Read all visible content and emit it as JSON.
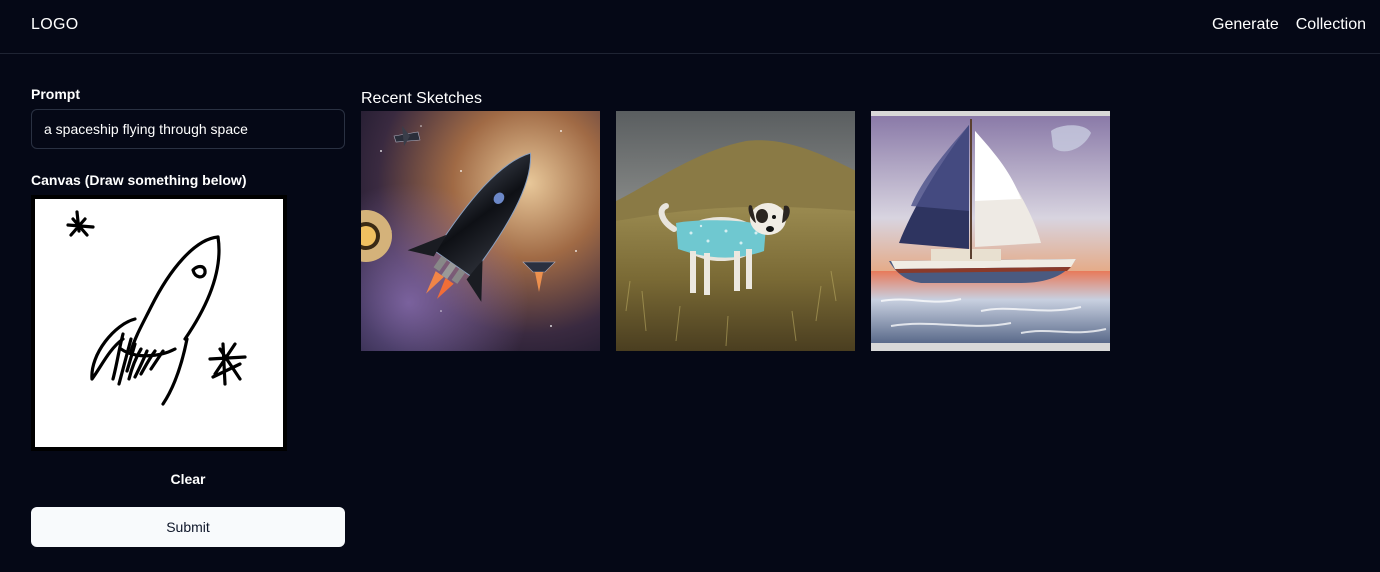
{
  "header": {
    "logo": "LOGO",
    "nav": [
      {
        "label": "Generate"
      },
      {
        "label": "Collection"
      }
    ]
  },
  "form": {
    "prompt_label": "Prompt",
    "prompt_value": "a spaceship flying through space",
    "canvas_label": "Canvas (Draw something below)",
    "clear_label": "Clear",
    "submit_label": "Submit"
  },
  "gallery": {
    "title": "Recent Sketches",
    "items": [
      {
        "subject": "rocket in space"
      },
      {
        "subject": "dog in blue coat on grassy hill"
      },
      {
        "subject": "sailboat on painted sea"
      }
    ]
  },
  "colors": {
    "background": "#050816",
    "submit_bg": "#f8fafc",
    "border": "#2a3142"
  }
}
